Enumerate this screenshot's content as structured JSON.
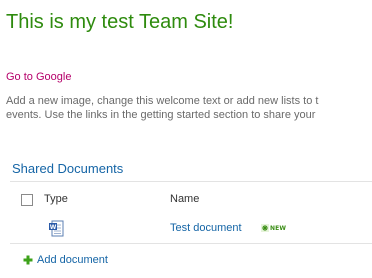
{
  "page": {
    "title": "This is my test Team Site!"
  },
  "links": {
    "google": "Go to Google"
  },
  "welcome": {
    "line1": "Add a new image, change this welcome text or add new lists to t",
    "line2": "events. Use the links in the getting started section to share your"
  },
  "webpart": {
    "title": "Shared Documents",
    "columns": {
      "type": "Type",
      "name": "Name"
    },
    "rows": [
      {
        "name": "Test document",
        "type_icon": "word-document-icon",
        "badge": "NEW"
      }
    ],
    "add_label": "Add document"
  },
  "colors": {
    "title": "#2e8b0e",
    "visited_link": "#b5006a",
    "link": "#1565a6",
    "new_badge": "#3b8e16",
    "add_icon": "#3da21a"
  }
}
